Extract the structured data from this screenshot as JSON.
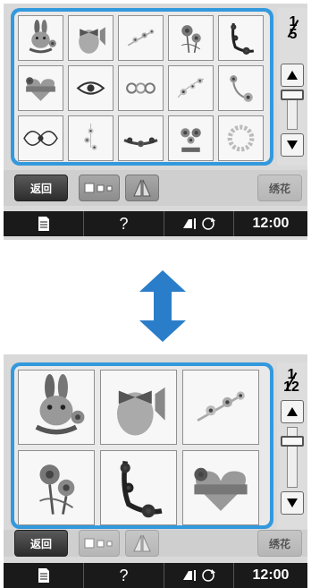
{
  "top_screen": {
    "page_indicator": {
      "current": "1",
      "total": "5"
    },
    "patterns": [
      "bunny-embroidery",
      "egg-bow-embroidery",
      "flower-spray-embroidery",
      "rose-embroidery",
      "vine-corner-embroidery",
      "heart-ribbon-embroidery",
      "eye-embroidery",
      "ornament-border-embroidery",
      "floral-sprig-embroidery",
      "flower-corner-embroidery",
      "lace-border-embroidery",
      "hanging-flower-embroidery",
      "garland-embroidery",
      "spring-bouquet-embroidery",
      "wreath-embroidery"
    ],
    "toolbar": {
      "back_label": "返回",
      "embroidery_label": "绣花"
    },
    "statusbar": {
      "clock": "12:00",
      "help": "?"
    }
  },
  "bottom_screen": {
    "page_indicator": {
      "current": "1",
      "total": "12"
    },
    "patterns": [
      "bunny-embroidery",
      "egg-bow-embroidery",
      "flower-spray-embroidery",
      "rose-embroidery",
      "vine-corner-embroidery",
      "heart-ribbon-embroidery"
    ],
    "toolbar": {
      "back_label": "返回",
      "embroidery_label": "绣花"
    },
    "statusbar": {
      "clock": "12:00",
      "help": "?"
    }
  },
  "colors": {
    "accent": "#3399dd",
    "arrow": "#2a7ec9",
    "status_bar": "#1a1a1a"
  }
}
